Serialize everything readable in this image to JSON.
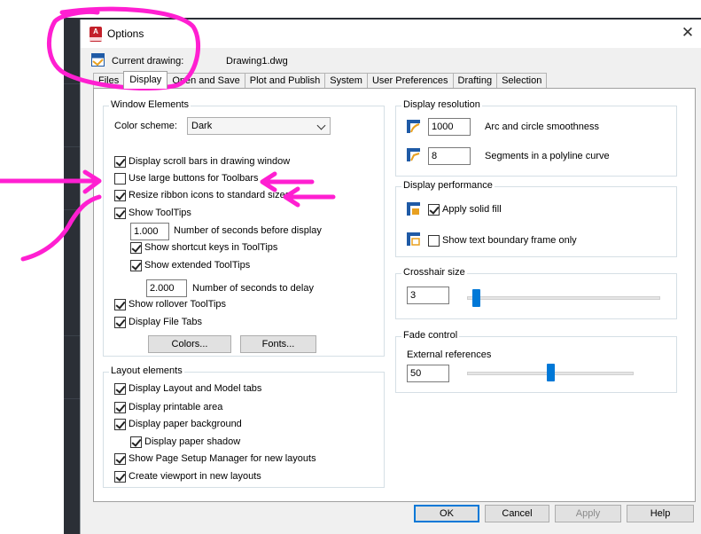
{
  "window": {
    "title": "Options",
    "close_glyph": "✕",
    "app_icon_letter": "A"
  },
  "current_drawing": {
    "label": "Current drawing:",
    "value": "Drawing1.dwg"
  },
  "tabs": [
    {
      "label": "Files",
      "active": false
    },
    {
      "label": "Display",
      "active": true
    },
    {
      "label": "Open and Save",
      "active": false
    },
    {
      "label": "Plot and Publish",
      "active": false
    },
    {
      "label": "System",
      "active": false
    },
    {
      "label": "User Preferences",
      "active": false
    },
    {
      "label": "Drafting",
      "active": false
    },
    {
      "label": "Selection",
      "active": false
    }
  ],
  "window_elements": {
    "title": "Window Elements",
    "color_scheme_label": "Color scheme:",
    "color_scheme_value": "Dark",
    "checkboxes": [
      {
        "label": "Display scroll bars in drawing window",
        "checked": true
      },
      {
        "label": "Use large buttons for Toolbars",
        "checked": false
      },
      {
        "label": "Resize ribbon icons to standard sizes",
        "checked": true
      },
      {
        "label": "Show ToolTips",
        "checked": true
      }
    ],
    "tooltip_seconds_value": "1.000",
    "tooltip_seconds_label": "Number of seconds before display",
    "show_shortcut_keys": {
      "label": "Show shortcut keys in ToolTips",
      "checked": true
    },
    "show_extended": {
      "label": "Show extended ToolTips",
      "checked": true
    },
    "delay_value": "2.000",
    "delay_label": "Number of seconds to delay",
    "show_rollover": {
      "label": "Show rollover ToolTips",
      "checked": true
    },
    "display_file_tabs": {
      "label": "Display File Tabs",
      "checked": true
    },
    "colors_button": "Colors...",
    "fonts_button": "Fonts..."
  },
  "layout_elements": {
    "title": "Layout elements",
    "items": [
      {
        "label": "Display Layout and Model tabs",
        "checked": true
      },
      {
        "label": "Display printable area",
        "checked": true
      },
      {
        "label": "Display paper background",
        "checked": true
      },
      {
        "label": "Display paper shadow",
        "checked": true
      },
      {
        "label": "Show Page Setup Manager for new layouts",
        "checked": true
      },
      {
        "label": "Create viewport in new layouts",
        "checked": true
      }
    ]
  },
  "display_resolution": {
    "title": "Display resolution",
    "arc_value": "1000",
    "arc_label": "Arc and circle smoothness",
    "segments_value": "8",
    "segments_label": "Segments in a polyline curve"
  },
  "display_performance": {
    "title": "Display performance",
    "apply_solid_fill": {
      "label": "Apply solid fill",
      "checked": true
    },
    "show_text_boundary": {
      "label": "Show text boundary frame only",
      "checked": false
    }
  },
  "crosshair": {
    "title": "Crosshair size",
    "value": "3",
    "slider_fraction": 0.03
  },
  "fade_control": {
    "title": "Fade control",
    "external_label": "External references",
    "value": "50",
    "slider_fraction": 0.5
  },
  "footer": {
    "ok": "OK",
    "cancel": "Cancel",
    "apply": "Apply",
    "help": "Help"
  },
  "colors": {
    "accent": "#0078d7",
    "annotation": "#ff1fd1",
    "dark_background": "#2b2f36",
    "app_icon": "#c3202a"
  }
}
